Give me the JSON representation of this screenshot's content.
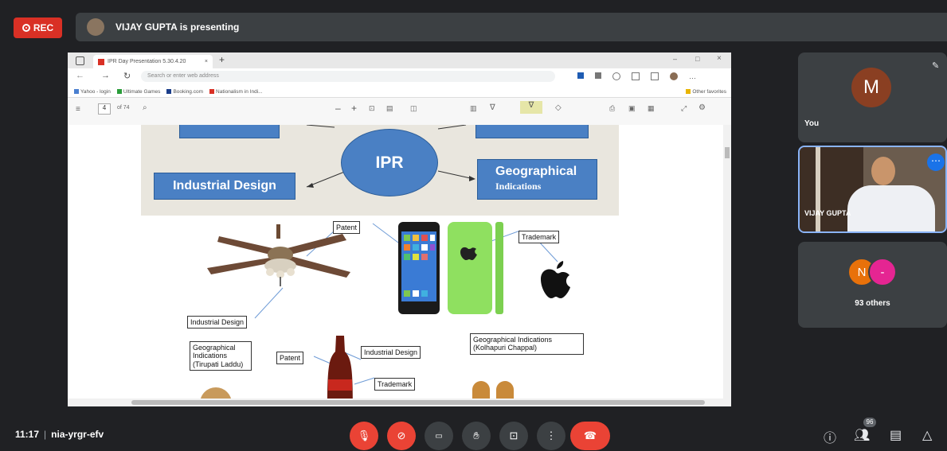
{
  "top": {
    "rec_label": "REC",
    "presenter_text": "VIJAY GUPTA is presenting"
  },
  "browser": {
    "tab_title": "IPR Day Presentation 5.30.4.20",
    "address_placeholder": "Search or enter web address",
    "favorites": [
      "Yahoo - login",
      "Ultimate Games",
      "Booking.com",
      "Nationalism in Indi..."
    ],
    "other_favorites": "Other favorites",
    "page_count": "of 74"
  },
  "slide": {
    "center": "IPR",
    "box_left": "Industrial Design",
    "box_right_line1": "Geographical",
    "box_right_line2": "Indications",
    "labels": {
      "patent_fan": "Patent",
      "trademark_phone": "Trademark",
      "industrial_design_fan": "Industrial Design",
      "gi_laddu": "Geographical Indications (Tirupati Laddu)",
      "patent_bottle": "Patent",
      "industrial_design_bottle": "Industrial Design",
      "trademark_bottle": "Trademark",
      "gi_chappal": "Geographical Indications (Kolhapuri Chappal)"
    }
  },
  "participants": {
    "you_initial": "M",
    "you_label": "You",
    "presenter_name": "VIJAY GUPTA",
    "others_initials": [
      "N",
      "-"
    ],
    "others_label": "93 others"
  },
  "bottom": {
    "time": "11:17",
    "separator": "|",
    "meeting_code": "nia-yrgr-efv",
    "people_badge": "96"
  },
  "colors": {
    "accent_red": "#ea4335",
    "tile_bg": "#3c4043",
    "slide_blue": "#4a80c4"
  }
}
